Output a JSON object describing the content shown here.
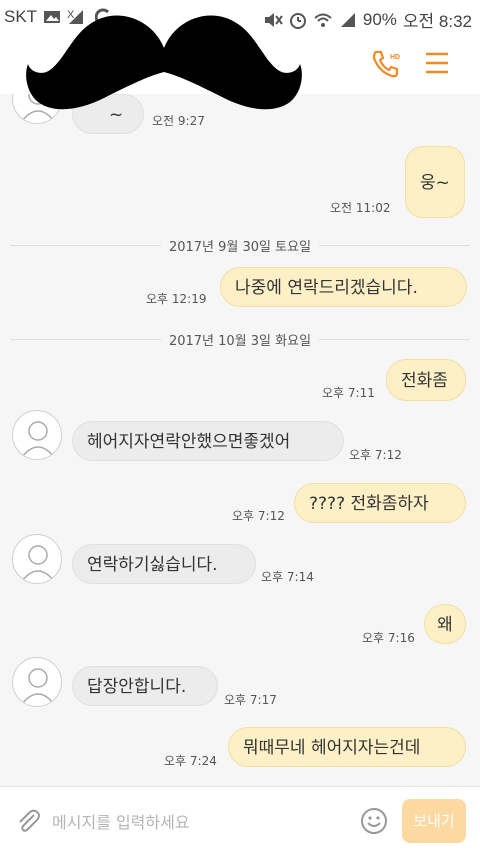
{
  "status_bar": {
    "carrier": "SKT",
    "battery": "90%",
    "clock": "오전 8:32"
  },
  "colors": {
    "accent": "#f08a24",
    "my_bubble": "#fdf0c7",
    "their_bubble": "#ececec",
    "send_button": "#fcd9a0"
  },
  "header": {
    "call_icon": "phone-hd-icon",
    "menu_icon": "hamburger-menu-icon"
  },
  "messages": [
    {
      "from": "them",
      "text": "~",
      "time": "오전 9:27"
    },
    {
      "from": "me",
      "text": "웅~",
      "time": "오전 11:02"
    },
    {
      "type": "date",
      "text": "2017년 9월 30일 토요일"
    },
    {
      "from": "me",
      "text": "나중에 연락드리겠습니다.",
      "time": "오후 12:19"
    },
    {
      "type": "date",
      "text": "2017년 10월 3일 화요일"
    },
    {
      "from": "me",
      "text": "전화좀",
      "time": "오후 7:11"
    },
    {
      "from": "them",
      "text": "헤어지자연락안했으면좋겠어",
      "time": "오후 7:12"
    },
    {
      "from": "me",
      "text": "???? 전화좀하자",
      "time": "오후 7:12"
    },
    {
      "from": "them",
      "text": "연락하기싫습니다.",
      "time": "오후 7:14"
    },
    {
      "from": "me",
      "text": "왜",
      "time": "오후 7:16"
    },
    {
      "from": "them",
      "text": "답장안합니다.",
      "time": "오후 7:17"
    },
    {
      "from": "me",
      "text": "뭐때무네 헤어지자는건데",
      "time": "오후 7:24"
    }
  ],
  "input_bar": {
    "placeholder": "메시지를 입력하세요",
    "send_label": "보내기"
  }
}
